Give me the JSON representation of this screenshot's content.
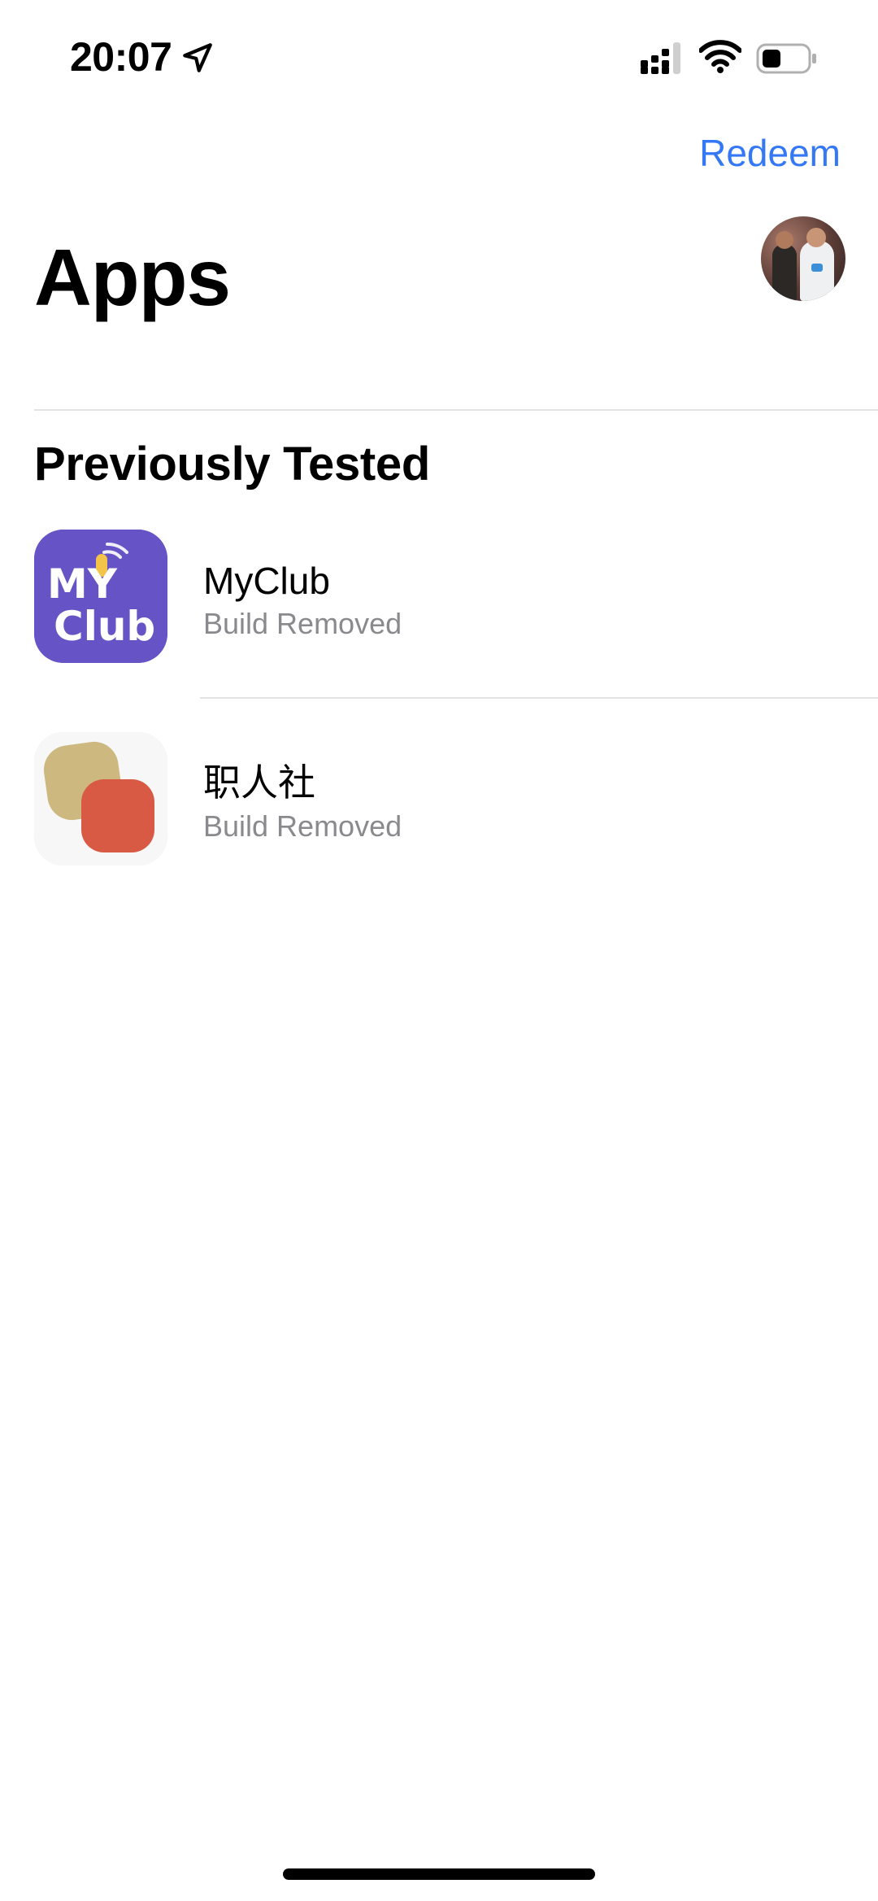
{
  "status_bar": {
    "time": "20:07"
  },
  "nav": {
    "redeem_label": "Redeem",
    "title": "Apps"
  },
  "section": {
    "header": "Previously Tested"
  },
  "apps": [
    {
      "name": "MyClub",
      "status": "Build Removed",
      "icon_text": {
        "line1": "MY",
        "line2": "Club"
      },
      "icon_color": "#6654c6"
    },
    {
      "name": "职人社",
      "status": "Build Removed",
      "icon_colors": [
        "#cdb880",
        "#d85a45"
      ]
    }
  ],
  "colors": {
    "accent": "#3478f6",
    "secondary_text": "#8a8a8e"
  }
}
